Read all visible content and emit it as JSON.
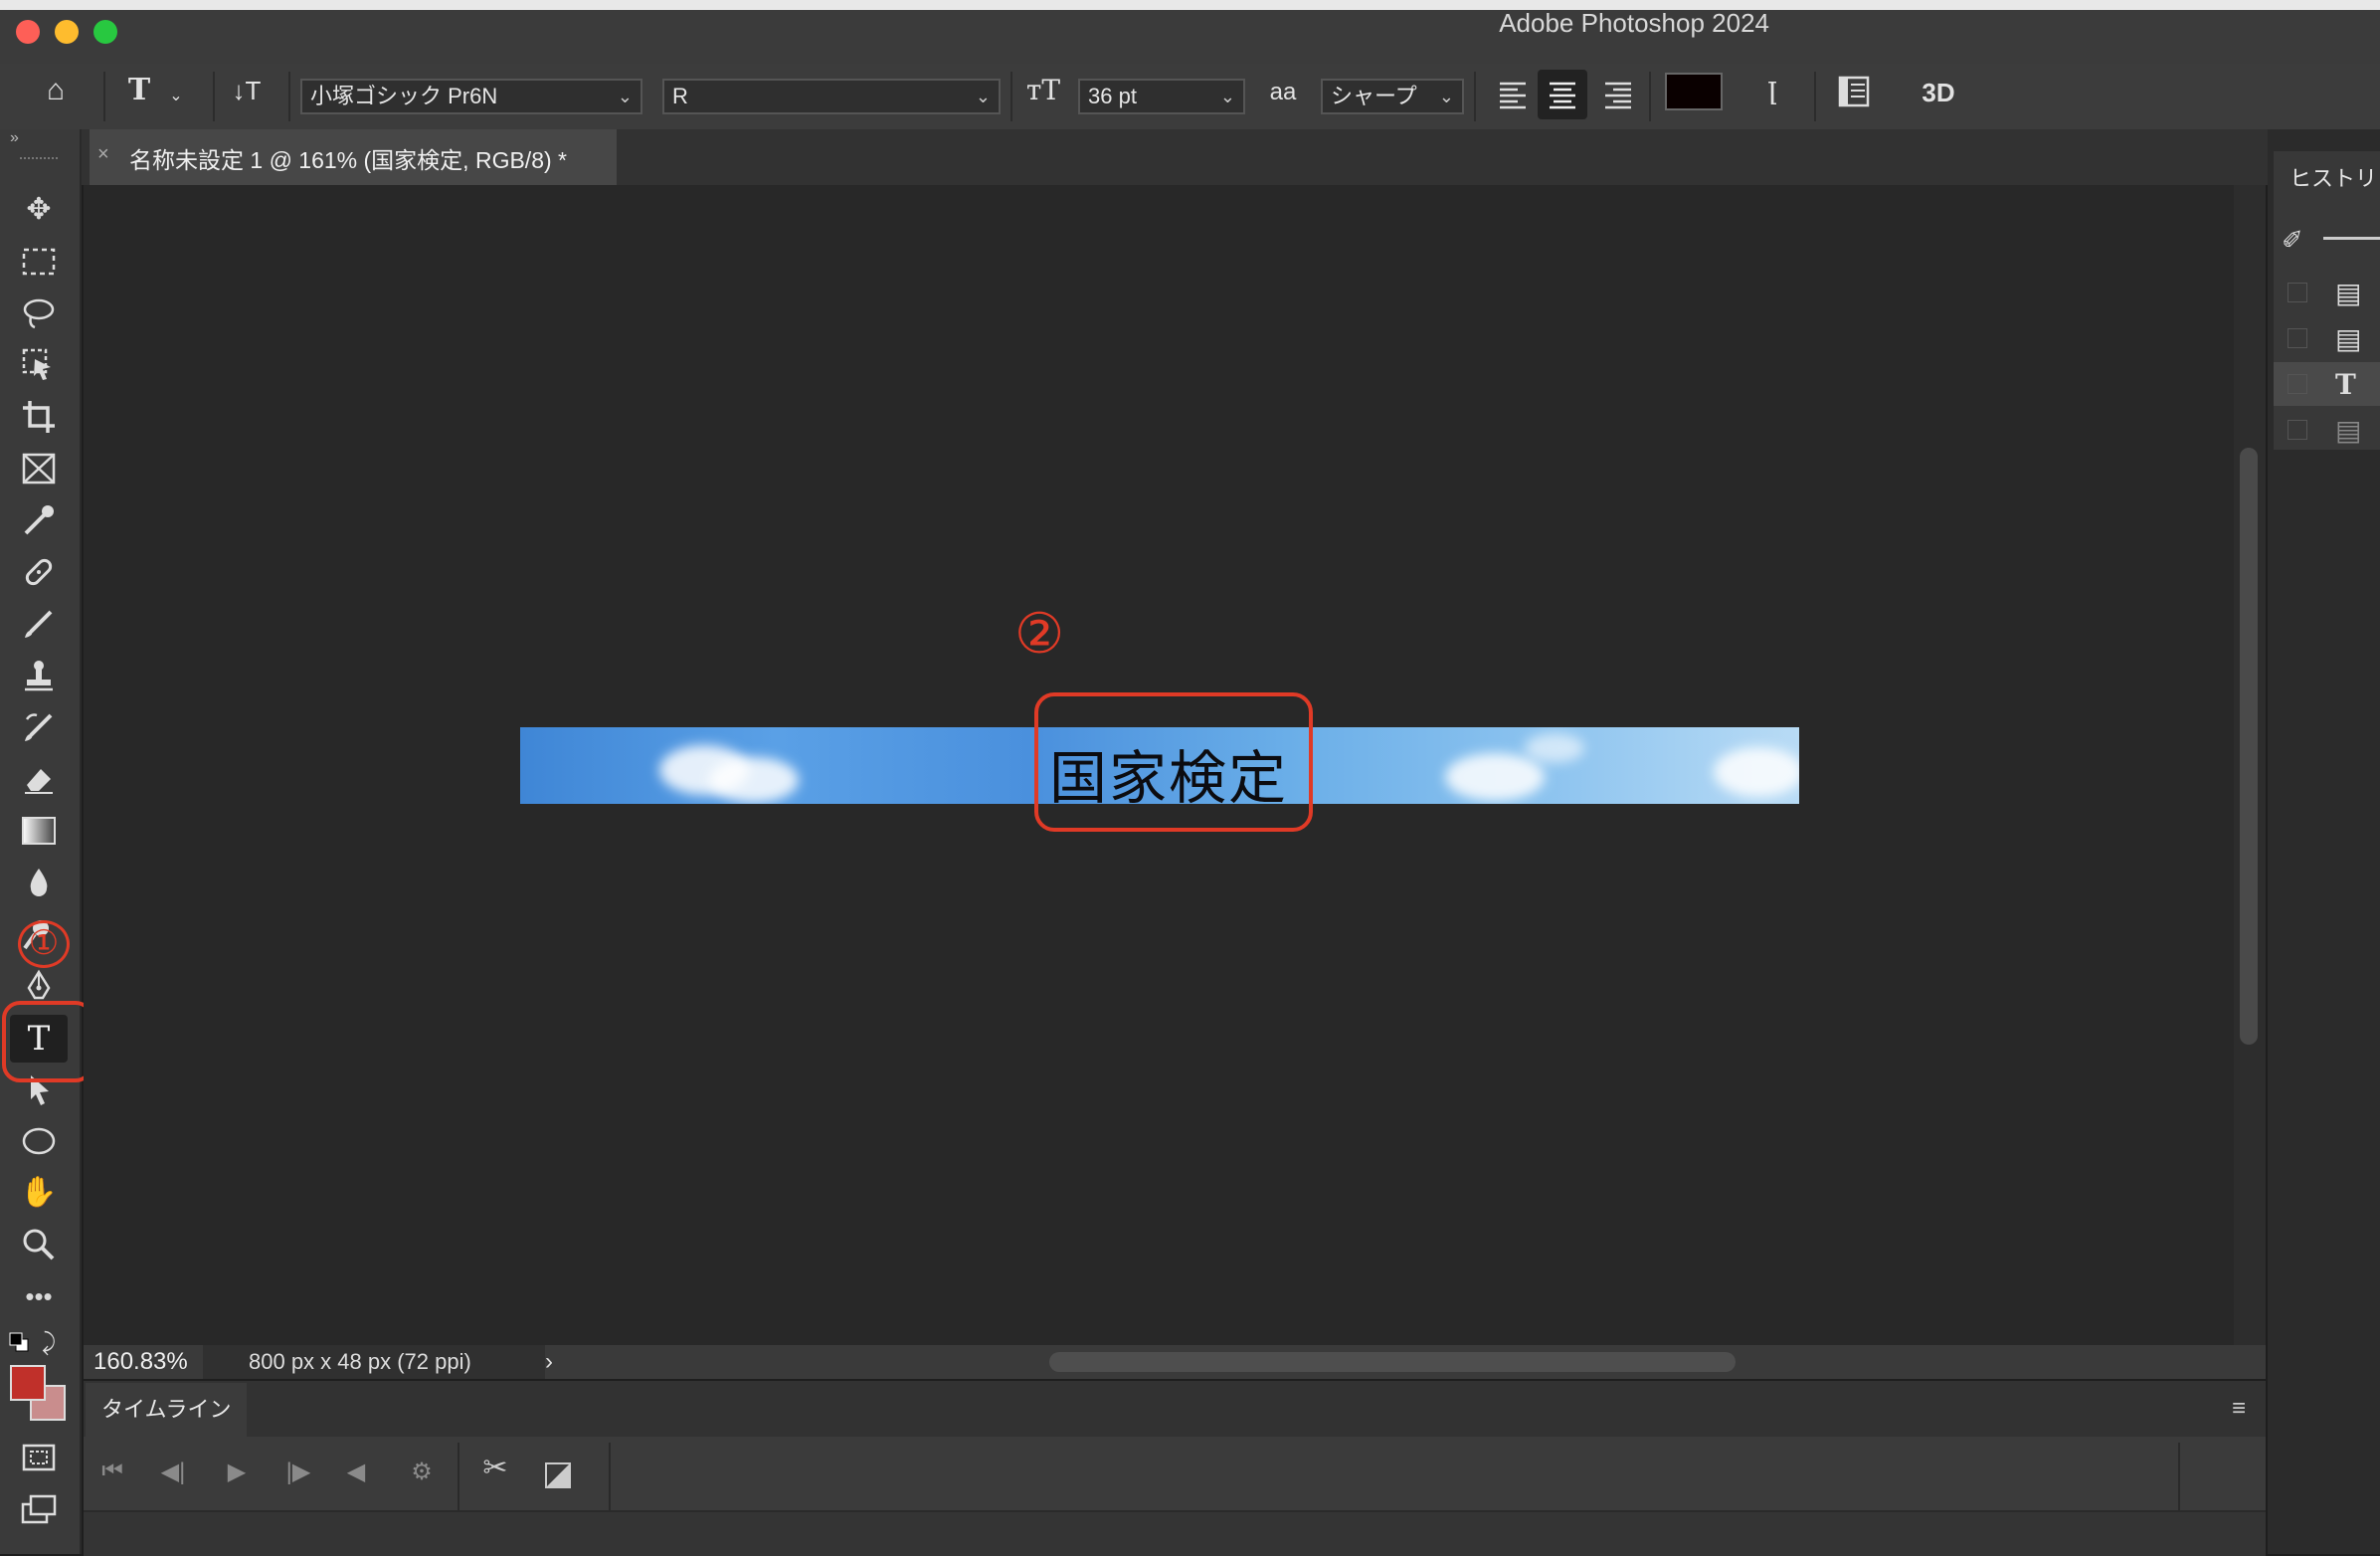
{
  "window": {
    "title": "Adobe Photoshop 2024"
  },
  "options_bar": {
    "font_family": "小塚ゴシック Pr6N",
    "font_style": "R",
    "font_size": "36 pt",
    "antialias": "シャープ",
    "aa_glyph": "aa",
    "three_d": "3D",
    "text_color": "#0a0000"
  },
  "document": {
    "tab_title": "名称未設定 1 @ 161% (国家検定, RGB/8) *",
    "text_layer": "国家検定",
    "zoom": "160.83%",
    "info": "800 px x 48 px (72 ppi)"
  },
  "annotations": {
    "step1": "①",
    "step2": "②"
  },
  "timeline": {
    "tab": "タイムライン"
  },
  "history": {
    "title": "ヒストリ"
  },
  "colors": {
    "annotation": "#e03a26",
    "foreground": "#c0302a",
    "background": "#c98d8d"
  }
}
